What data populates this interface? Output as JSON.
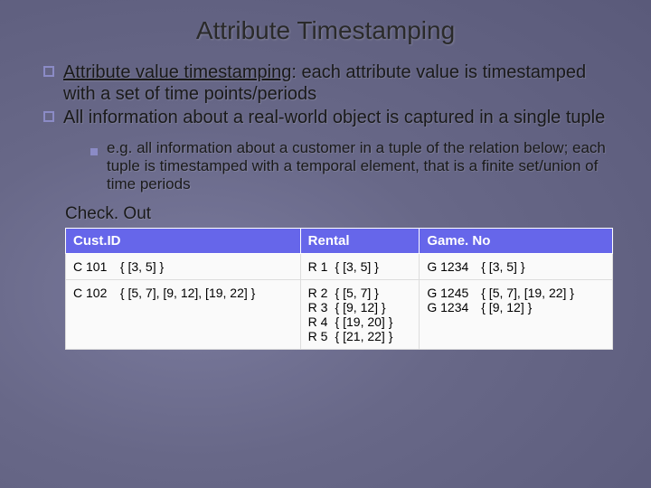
{
  "title": "Attribute Timestamping",
  "bullets": [
    {
      "lead": "Attribute value timestamping",
      "rest": ": each attribute value is timestamped with a set of time points/periods"
    },
    {
      "lead": "",
      "rest": "All information about a real-world object is captured in a single tuple"
    }
  ],
  "sub": "e.g. all information about a customer in a tuple of the relation below; each tuple is timestamped with a temporal element, that is a finite set/union of time periods",
  "table": {
    "name": "Check. Out",
    "headers": [
      "Cust.ID",
      "Rental",
      "Game. No"
    ],
    "rows": [
      {
        "cust": [
          {
            "k": "C 101",
            "v": "{ [3, 5] }"
          }
        ],
        "rental": [
          {
            "k": "R 1",
            "v": "{ [3, 5] }"
          }
        ],
        "game": [
          {
            "k": "G 1234",
            "v": "{ [3, 5] }"
          }
        ]
      },
      {
        "cust": [
          {
            "k": "C 102",
            "v": "{ [5, 7], [9, 12], [19, 22] }"
          }
        ],
        "rental": [
          {
            "k": "R 2",
            "v": "{ [5, 7] }"
          },
          {
            "k": "R 3",
            "v": "{ [9, 12] }"
          },
          {
            "k": "R 4",
            "v": "{ [19, 20] }"
          },
          {
            "k": "R 5",
            "v": "{ [21, 22] }"
          }
        ],
        "game": [
          {
            "k": "G 1245",
            "v": "{ [5, 7], [19, 22] }"
          },
          {
            "k": "G 1234",
            "v": "{ [9, 12] }"
          }
        ]
      }
    ]
  }
}
